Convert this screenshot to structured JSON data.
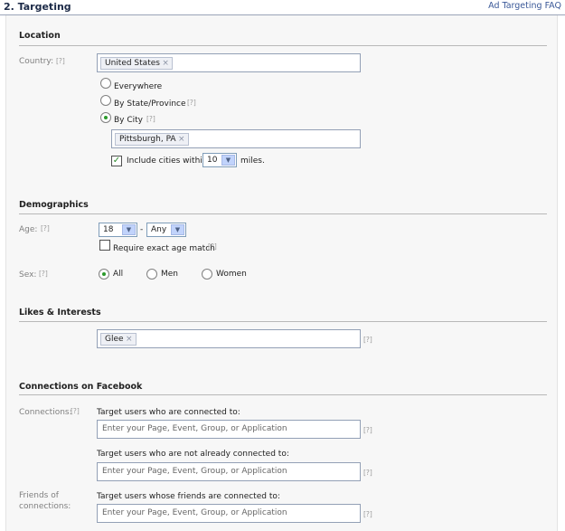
{
  "header": {
    "title": "2. Targeting",
    "faq_link": "Ad Targeting FAQ"
  },
  "help_glyph": "[?]",
  "location": {
    "title": "Location",
    "country_label": "Country:",
    "country_token": "United States",
    "options": [
      "Everywhere",
      "By State/Province",
      "By City"
    ],
    "selected": "By City",
    "city_token": "Pittsburgh, PA",
    "include_label": "Include cities within",
    "include_checked": true,
    "radius": "10",
    "radius_unit": "miles."
  },
  "demographics": {
    "title": "Demographics",
    "age_label": "Age:",
    "age_min": "18",
    "age_separator": "-",
    "age_max": "Any",
    "exact_age_label": "Require exact age match",
    "exact_age_checked": false,
    "sex_label": "Sex:",
    "sex_options": [
      "All",
      "Men",
      "Women"
    ],
    "sex_selected": "All"
  },
  "likes": {
    "title": "Likes & Interests",
    "token": "Glee"
  },
  "connections": {
    "title": "Connections on Facebook",
    "connections_label": "Connections:",
    "connected_label": "Target users who are connected to:",
    "not_connected_label": "Target users who are not already connected to:",
    "friends_label_line1": "Friends of",
    "friends_label_line2": "connections:",
    "friends_connected_label": "Target users whose friends are connected to:",
    "placeholder": "Enter your Page, Event, Group, or Application"
  },
  "icons": {
    "remove": "×",
    "dropdown": "▼",
    "check": "✓"
  },
  "colors": {
    "link": "#3b5998",
    "radio_selected": "#2b9a2b",
    "check": "#2b8a2b"
  }
}
